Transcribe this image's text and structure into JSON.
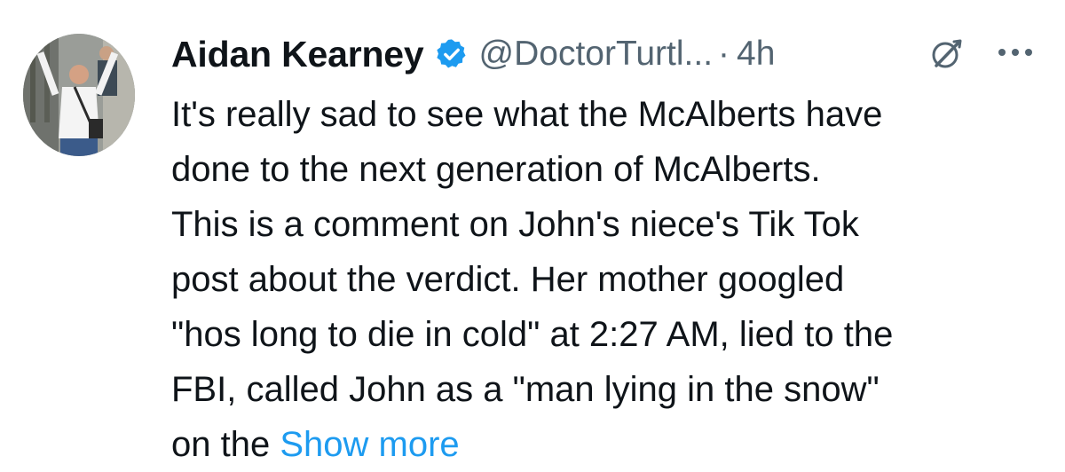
{
  "tweet": {
    "author_name": "Aidan Kearney",
    "handle": "@DoctorTurtl...",
    "separator": "·",
    "time": "4h",
    "verified_icon": "verified-badge-icon",
    "grok_icon": "grok-icon",
    "more_icon": "more-options-icon",
    "body_lines": [
      "It's really sad to see what the McAlberts have",
      "done to the next generation of McAlberts.",
      "This is a comment on John's niece's Tik Tok",
      "post about the verdict. Her mother googled",
      "\"hos long to die in cold\" at 2:27 AM, lied to the",
      "FBI, called John as a \"man lying in the snow\"",
      "on the"
    ],
    "show_more_label": "Show more",
    "colors": {
      "text": "#0f1419",
      "secondary": "#536471",
      "link": "#1d9bf0",
      "verified": "#1d9bf0"
    }
  }
}
